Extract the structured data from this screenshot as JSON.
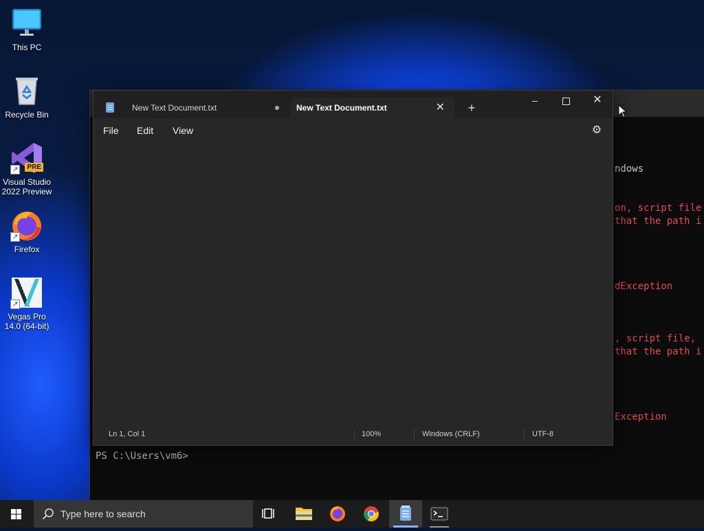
{
  "desktop": {
    "icons": [
      {
        "label": "This PC"
      },
      {
        "label": "Recycle Bin"
      },
      {
        "label": "Visual Studio 2022 Preview",
        "badge": "PRE"
      },
      {
        "label": "Firefox"
      },
      {
        "label": "Vegas Pro 14.0 (64-bit)"
      }
    ]
  },
  "terminal": {
    "lines": [
      {
        "text": "ndows",
        "color": "white"
      },
      {
        "text": "on, script file",
        "color": "red"
      },
      {
        "text": "that the path i",
        "color": "red"
      },
      {
        "text": "dException",
        "color": "red"
      },
      {
        "text": ", script file,",
        "color": "red"
      },
      {
        "text": "that the path i",
        "color": "red"
      },
      {
        "text": "Exception",
        "color": "red"
      }
    ],
    "prompt": "PS C:\\Users\\vm6>"
  },
  "notepad": {
    "tabs": [
      {
        "title": "New Text Document.txt",
        "active": false,
        "unsaved": true
      },
      {
        "title": "New Text Document.txt",
        "active": true,
        "unsaved": false
      }
    ],
    "new_tab_label": "+",
    "controls": {
      "minimize": "–",
      "close": "✕"
    },
    "menu": {
      "file": "File",
      "edit": "Edit",
      "view": "View"
    },
    "settings_icon": "gear-icon",
    "content": "",
    "status": {
      "position": "Ln 1, Col 1",
      "zoom": "100%",
      "line_ending": "Windows (CRLF)",
      "encoding": "UTF-8"
    }
  },
  "taskbar": {
    "search_placeholder": "Type here to search",
    "apps": [
      "task-view",
      "file-explorer",
      "firefox",
      "chrome",
      "notepad",
      "terminal"
    ],
    "active_app": "notepad"
  },
  "colors": {
    "accent": "#8ab4f8",
    "notepad_bg": "#272727",
    "terminal_error": "#e5484d"
  }
}
